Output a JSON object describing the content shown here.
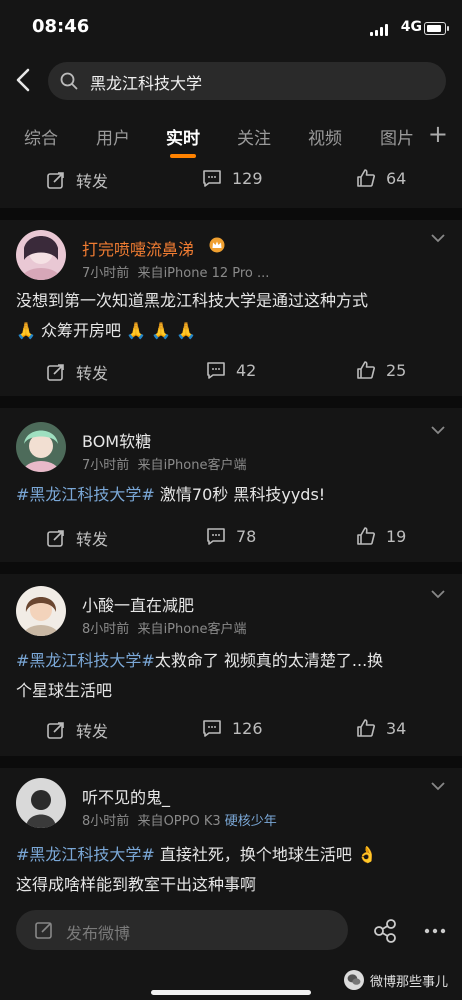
{
  "status": {
    "time": "08:46",
    "network": "4G"
  },
  "search": {
    "query": "黑龙江科技大学"
  },
  "tabs": [
    "综合",
    "用户",
    "实时",
    "关注",
    "视频",
    "图片"
  ],
  "tabs_more": "+",
  "actions_top": {
    "repost": "转发",
    "comments": "129",
    "likes": "64"
  },
  "posts": [
    {
      "user": "打完喷嚏流鼻涕",
      "time": "7小时前",
      "source_prefix": "来自",
      "source": "iPhone 12 Pro ...",
      "text_line1": "没想到第一次知道黑龙江科技大学是通过这种方式",
      "text_line2": "🙏 众筹开房吧 🙏 🙏 🙏",
      "repost": "转发",
      "comments": "42",
      "likes": "25"
    },
    {
      "user": "BOM软糖",
      "time": "7小时前",
      "source_prefix": "来自",
      "source": "iPhone客户端",
      "tag": "#黑龙江科技大学#",
      "text": " 激情70秒 黑科技yyds!",
      "repost": "转发",
      "comments": "78",
      "likes": "19"
    },
    {
      "user": "小酸一直在减肥",
      "time": "8小时前",
      "source_prefix": "来自",
      "source": "iPhone客户端",
      "tag": "#黑龙江科技大学#",
      "text": "太救命了 视频真的太清楚了...换",
      "text_line2": "个星球生活吧",
      "repost": "转发",
      "comments": "126",
      "likes": "34"
    },
    {
      "user": "听不见的鬼_",
      "time": "8小时前",
      "source_prefix": "来自",
      "source": "OPPO K3",
      "source_suffix": "硬核少年",
      "tag": "#黑龙江科技大学#",
      "text": " 直接社死，换个地球生活吧 👌",
      "text_line2": "这得成啥样能到教室干出这种事啊"
    }
  ],
  "compose": {
    "placeholder": "发布微博"
  },
  "watermark": "微博那些事儿"
}
